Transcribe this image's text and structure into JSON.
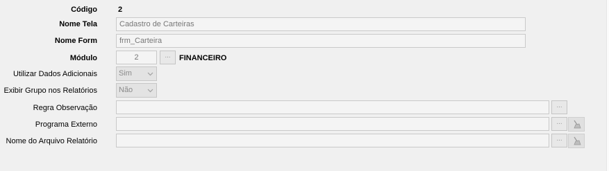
{
  "form": {
    "codigo": {
      "label": "Código",
      "value": "2"
    },
    "nome_tela": {
      "label": "Nome Tela",
      "value": "Cadastro de Carteiras"
    },
    "nome_form": {
      "label": "Nome Form",
      "value": "frm_Carteira"
    },
    "modulo": {
      "label": "Módulo",
      "value": "2",
      "lookup_label": "...",
      "name": "FINANCEIRO"
    },
    "utilizar_dados_adicionais": {
      "label": "Utilizar Dados Adicionais",
      "value": "Sim"
    },
    "exibir_grupo_relatorios": {
      "label": "Exibir Grupo nos Relatórios",
      "value": "Não"
    },
    "regra_observacao": {
      "label": "Regra Observação",
      "value": "",
      "lookup_label": "..."
    },
    "programa_externo": {
      "label": "Programa Externo",
      "value": "",
      "lookup_label": "..."
    },
    "nome_arquivo_relatorio": {
      "label": "Nome do Arquivo Relatório",
      "value": "",
      "lookup_label": "..."
    }
  },
  "icons": {
    "combo_arrow": "chevron-down-icon",
    "clear": "broom-icon"
  }
}
